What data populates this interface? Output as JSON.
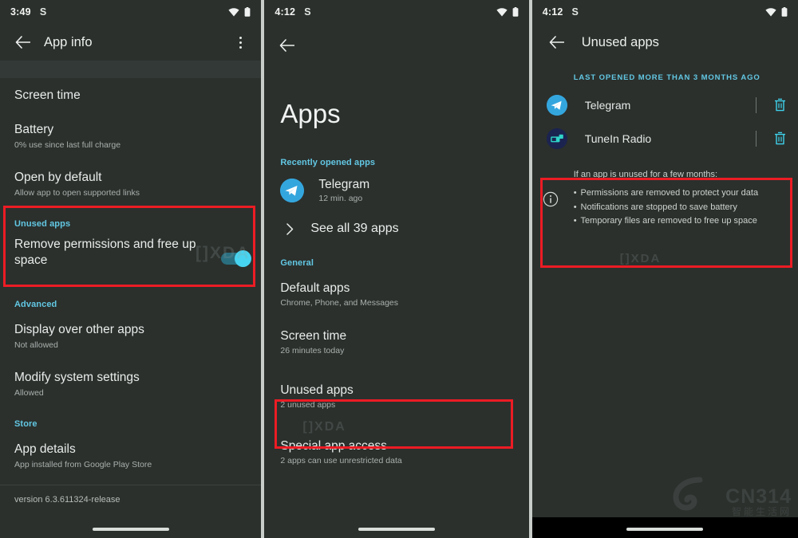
{
  "panels": {
    "app_info": {
      "status": {
        "time": "3:49",
        "silent_icon": "s-glyph-icon",
        "wifi_icon": "wifi-icon",
        "battery_icon": "battery-icon"
      },
      "appbar": {
        "back_icon": "back-arrow-icon",
        "title": "App info",
        "overflow_icon": "kebab-menu-icon"
      },
      "rows": [
        {
          "title": "Screen time",
          "subtitle": ""
        },
        {
          "title": "Battery",
          "subtitle": "0% use since last full charge"
        },
        {
          "title": "Open by default",
          "subtitle": "Allow app to open supported links"
        }
      ],
      "unused_section": {
        "header": "Unused apps",
        "title": "Remove permissions and free up space",
        "toggle_on": true
      },
      "advanced_header": "Advanced",
      "advanced_rows": [
        {
          "title": "Display over other apps",
          "subtitle": "Not allowed"
        },
        {
          "title": "Modify system settings",
          "subtitle": "Allowed"
        }
      ],
      "store_header": "Store",
      "store_rows": [
        {
          "title": "App details",
          "subtitle": "App installed from Google Play Store"
        }
      ],
      "version": "version 6.3.611324-release",
      "watermark": "[]XDA"
    },
    "apps": {
      "status": {
        "time": "4:12",
        "silent_icon": "s-glyph-icon",
        "wifi_icon": "wifi-icon",
        "battery_icon": "battery-icon"
      },
      "appbar": {
        "back_icon": "back-arrow-icon",
        "title": ""
      },
      "big_title": "Apps",
      "recent_header": "Recently opened apps",
      "recent_app": {
        "name": "Telegram",
        "subtitle": "12 min. ago",
        "icon": "telegram-icon"
      },
      "see_all": "See all 39 apps",
      "general_header": "General",
      "general_rows": [
        {
          "title": "Default apps",
          "subtitle": "Chrome, Phone, and Messages"
        },
        {
          "title": "Screen time",
          "subtitle": "26 minutes today"
        },
        {
          "title": "Unused apps",
          "subtitle": "2 unused apps",
          "highlighted": true
        },
        {
          "title": "Special app access",
          "subtitle": "2 apps can use unrestricted data"
        }
      ],
      "watermark": "[]XDA"
    },
    "unused_apps": {
      "status": {
        "time": "4:12",
        "silent_icon": "s-glyph-icon",
        "wifi_icon": "wifi-icon",
        "battery_icon": "battery-icon"
      },
      "appbar": {
        "back_icon": "back-arrow-icon",
        "title": "Unused apps"
      },
      "section_caps": "LAST OPENED MORE THAN 3 MONTHS AGO",
      "apps": [
        {
          "name": "Telegram",
          "icon": "telegram-icon",
          "delete_icon": "trash-icon"
        },
        {
          "name": "TuneIn Radio",
          "icon": "tunein-radio-icon",
          "delete_icon": "trash-icon"
        }
      ],
      "info": {
        "icon": "info-circle-icon",
        "lead": "If an app is unused for a few months:",
        "bullets": [
          "Permissions are removed to protect your data",
          "Notifications are stopped to save battery",
          "Temporary files are removed to free up space"
        ]
      },
      "watermark": "[]XDA",
      "site_watermark": {
        "name": "CN314",
        "tagline": "智能生活网"
      }
    }
  },
  "colors": {
    "background": "#2b302d",
    "accent_blue": "#62c7e3",
    "highlight_red": "#ec1c24",
    "toggle_on": "#47d4f0",
    "text_primary": "#e9ecea",
    "text_secondary": "#a9b0ac"
  }
}
